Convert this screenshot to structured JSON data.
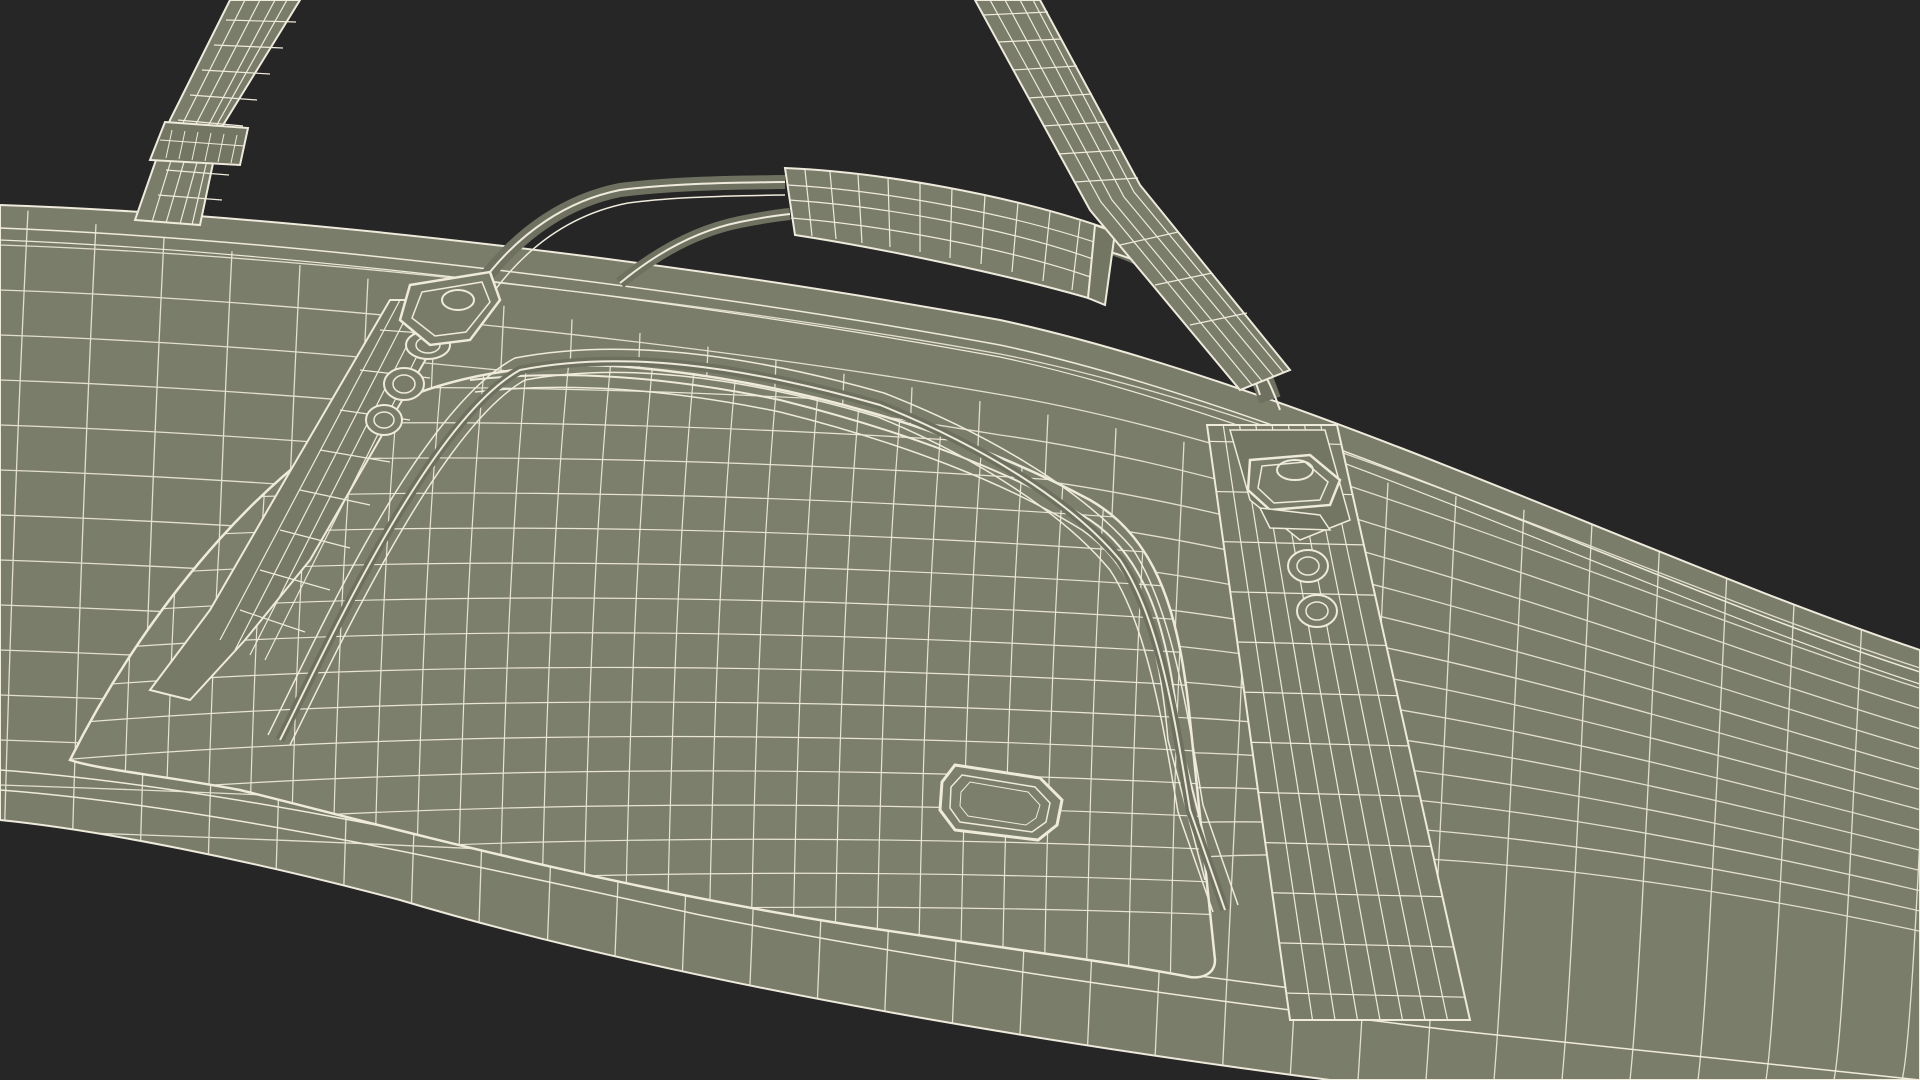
{
  "scene": {
    "subject": "wireframe-rifle-case",
    "colors": {
      "background": "#262626",
      "surface": "#7b7d6b",
      "surface_dark": "#6a6c5c",
      "surface_light": "#878975",
      "wire": "#eeeadc"
    }
  }
}
